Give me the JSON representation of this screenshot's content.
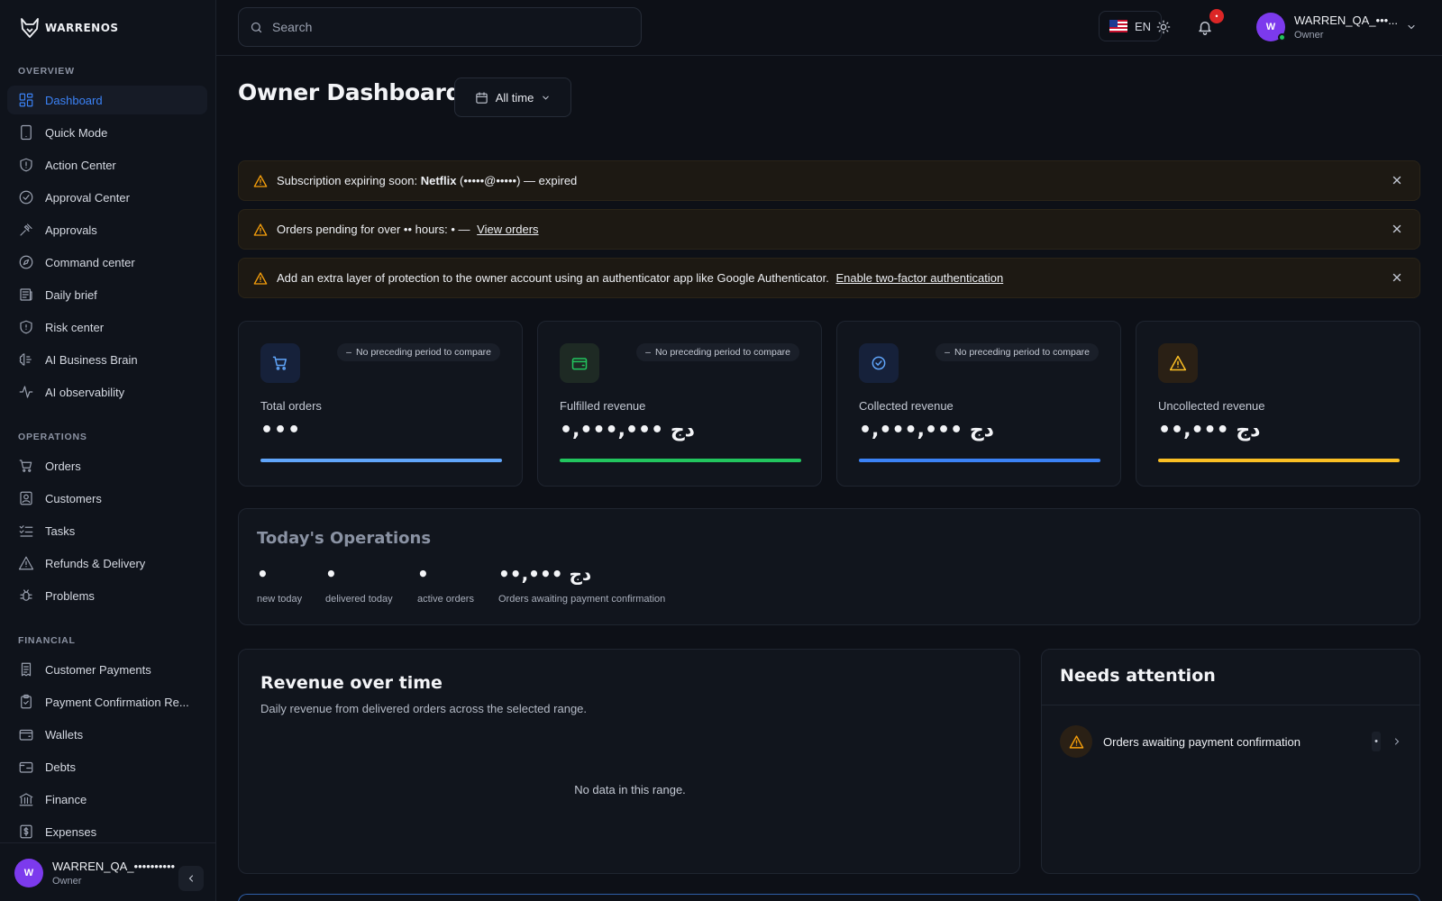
{
  "brand": {
    "name": "WARRENOS"
  },
  "sidebar": {
    "sections": [
      {
        "title": "OVERVIEW",
        "items": [
          {
            "label": "Dashboard",
            "icon": "dashboard-icon",
            "active": true
          },
          {
            "label": "Quick Mode",
            "icon": "tablet-icon"
          },
          {
            "label": "Action Center",
            "icon": "shield-icon"
          },
          {
            "label": "Approval Center",
            "icon": "check-circle-icon"
          },
          {
            "label": "Approvals",
            "icon": "gavel-icon"
          },
          {
            "label": "Command center",
            "icon": "compass-icon"
          },
          {
            "label": "Daily brief",
            "icon": "newspaper-icon"
          },
          {
            "label": "Risk center",
            "icon": "shield-alert-icon"
          },
          {
            "label": "AI Business Brain",
            "icon": "brain-icon"
          },
          {
            "label": "AI observability",
            "icon": "activity-icon"
          }
        ]
      },
      {
        "title": "OPERATIONS",
        "items": [
          {
            "label": "Orders",
            "icon": "cart-icon"
          },
          {
            "label": "Customers",
            "icon": "contact-icon"
          },
          {
            "label": "Tasks",
            "icon": "list-check-icon"
          },
          {
            "label": "Refunds & Delivery",
            "icon": "warning-icon"
          },
          {
            "label": "Problems",
            "icon": "bug-icon"
          }
        ]
      },
      {
        "title": "FINANCIAL",
        "items": [
          {
            "label": "Customer Payments",
            "icon": "receipt-icon"
          },
          {
            "label": "Payment Confirmation Re...",
            "icon": "clipboard-check-icon"
          },
          {
            "label": "Wallets",
            "icon": "wallet-icon"
          },
          {
            "label": "Debts",
            "icon": "wallet-minus-icon"
          },
          {
            "label": "Finance",
            "icon": "bank-icon"
          },
          {
            "label": "Expenses",
            "icon": "dollar-receipt-icon"
          }
        ]
      }
    ],
    "footer": {
      "avatar_initial": "W",
      "name": "WARREN_QA_••••••••••",
      "role": "Owner"
    }
  },
  "topbar": {
    "search_placeholder": "Search",
    "language": "EN",
    "notification_count": "•",
    "user": {
      "avatar_initial": "W",
      "name": "WARREN_QA_•••...",
      "role": "Owner"
    }
  },
  "main": {
    "title": "Owner Dashboard",
    "range_label": "All time",
    "alerts": [
      {
        "prefix": "Subscription expiring soon: ",
        "bold": "Netflix",
        "suffix": " (•••••@•••••) — expired",
        "link": ""
      },
      {
        "prefix": "Orders pending for over •• hours: • —",
        "bold": "",
        "suffix": "",
        "link": "View orders"
      },
      {
        "prefix": "Add an extra layer of protection to the owner account using an authenticator app like Google Authenticator.",
        "bold": "",
        "suffix": "",
        "link": "Enable two-factor authentication"
      }
    ],
    "cards": [
      {
        "label": "Total orders",
        "value": "•••",
        "pill": "No preceding period to compare",
        "accent": "#60a5fa",
        "icon": "cart-icon"
      },
      {
        "label": "Fulfilled revenue",
        "value": "•,•••,••• دج",
        "pill": "No preceding period to compare",
        "accent": "#22c55e",
        "icon": "wallet-icon"
      },
      {
        "label": "Collected revenue",
        "value": "•,•••,••• دج",
        "pill": "No preceding period to compare",
        "accent": "#3b82f6",
        "icon": "check-badge-icon"
      },
      {
        "label": "Uncollected revenue",
        "value": "••,••• دج",
        "pill": "",
        "accent": "#fbbf24",
        "icon": "warning-icon"
      }
    ],
    "operations": {
      "title": "Today's Operations",
      "stats": [
        {
          "value": "•",
          "label": "new today"
        },
        {
          "value": "•",
          "label": "delivered today"
        },
        {
          "value": "•",
          "label": "active orders"
        },
        {
          "value": "••,••• دج",
          "label": "Orders awaiting payment confirmation"
        }
      ]
    },
    "revenue": {
      "title": "Revenue over time",
      "subtitle": "Daily revenue from delivered orders across the selected range.",
      "empty": "No data in this range."
    },
    "attention": {
      "title": "Needs attention",
      "items": [
        {
          "label": "Orders awaiting payment confirmation",
          "count": "•"
        }
      ]
    }
  }
}
